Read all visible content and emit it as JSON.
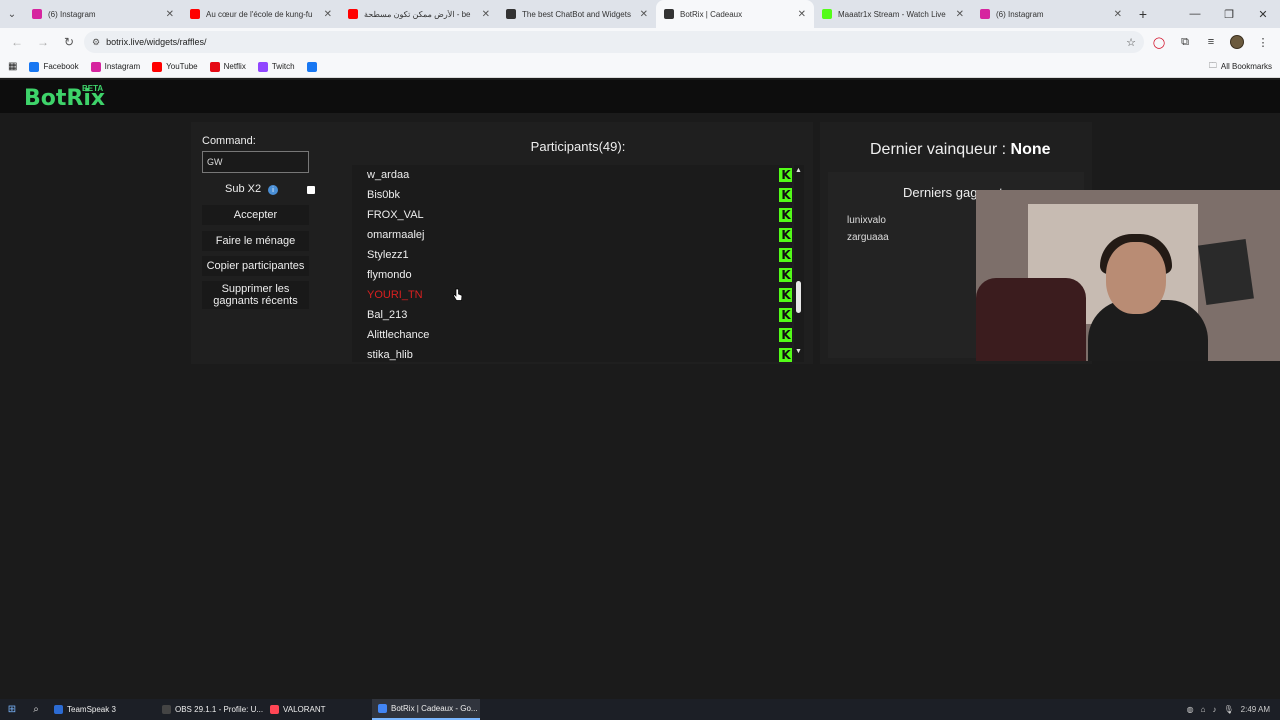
{
  "browser": {
    "tabs": [
      {
        "label": "(6) Instagram",
        "icon": "instagram-icon",
        "color": "#d6249f"
      },
      {
        "label": "Au cœur de l'école de kung-fu",
        "icon": "youtube-icon",
        "color": "#ff0000"
      },
      {
        "label": "الأرض ممكن تكون مسطحة - be",
        "icon": "youtube-icon",
        "color": "#ff0000"
      },
      {
        "label": "The best ChatBot and Widgets",
        "icon": "botrix-icon",
        "color": "#333333"
      },
      {
        "label": "BotRix | Cadeaux",
        "icon": "botrix-icon",
        "color": "#333333",
        "active": true
      },
      {
        "label": "Maaatr1x Stream - Watch Live",
        "icon": "kick-icon",
        "color": "#53fc18"
      },
      {
        "label": "(6) Instagram",
        "icon": "instagram-icon",
        "color": "#d6249f"
      }
    ],
    "new_tab": "+",
    "url": "botrix.live/widgets/raffles/",
    "bookmarks": [
      {
        "label": "Facebook",
        "icon": "facebook-icon",
        "color": "#1877f2"
      },
      {
        "label": "Instagram",
        "icon": "instagram-icon",
        "color": "#d6249f"
      },
      {
        "label": "YouTube",
        "icon": "youtube-icon",
        "color": "#ff0000"
      },
      {
        "label": "Netflix",
        "icon": "netflix-icon",
        "color": "#e50914"
      },
      {
        "label": "Twitch",
        "icon": "twitch-icon",
        "color": "#9146ff"
      },
      {
        "label": "",
        "icon": "facebook-icon",
        "color": "#1877f2"
      }
    ],
    "all_bookmarks": "All Bookmarks"
  },
  "app": {
    "logo": "BotRix",
    "beta": "BETA",
    "accent": "#3ed36a"
  },
  "controls": {
    "command_label": "Command:",
    "command_value": "GW",
    "sub_label": "Sub X2",
    "buttons": {
      "accept": "Accepter",
      "clean": "Faire le ménage",
      "copy": "Copier participantes",
      "delete": "Supprimer les gagnants récents"
    }
  },
  "participants": {
    "title": "Participants(49):",
    "kick_color": "#53fc18",
    "items": [
      {
        "name": "w_ardaa",
        "highlight": false
      },
      {
        "name": "Bis0bk",
        "highlight": false
      },
      {
        "name": "FROX_VAL",
        "highlight": false
      },
      {
        "name": "omarmaalej",
        "highlight": false
      },
      {
        "name": "Stylezz1",
        "highlight": false
      },
      {
        "name": "flymondo",
        "highlight": false
      },
      {
        "name": "YOURI_TN",
        "highlight": true
      },
      {
        "name": "Bal_213",
        "highlight": false
      },
      {
        "name": "Alittlechance",
        "highlight": false
      },
      {
        "name": "stika_hlib",
        "highlight": false
      }
    ]
  },
  "results": {
    "last_winner_label": "Dernier vainqueur :",
    "last_winner_value": "None",
    "recent_title": "Derniers gagnants :",
    "recent_winners": [
      "lunixvalo",
      "zarguaaa"
    ]
  },
  "taskbar": {
    "apps": [
      {
        "label": "TeamSpeak 3",
        "icon": "teamspeak-icon",
        "color": "#2c6bd3"
      },
      {
        "label": "OBS 29.1.1 - Profile: U...",
        "icon": "obs-icon",
        "color": "#444444"
      },
      {
        "label": "VALORANT",
        "icon": "valorant-icon",
        "color": "#ff4655"
      },
      {
        "label": "BotRix | Cadeaux - Go...",
        "icon": "chrome-icon",
        "color": "#4285f4",
        "active": true
      }
    ],
    "time": "2:49 AM"
  }
}
